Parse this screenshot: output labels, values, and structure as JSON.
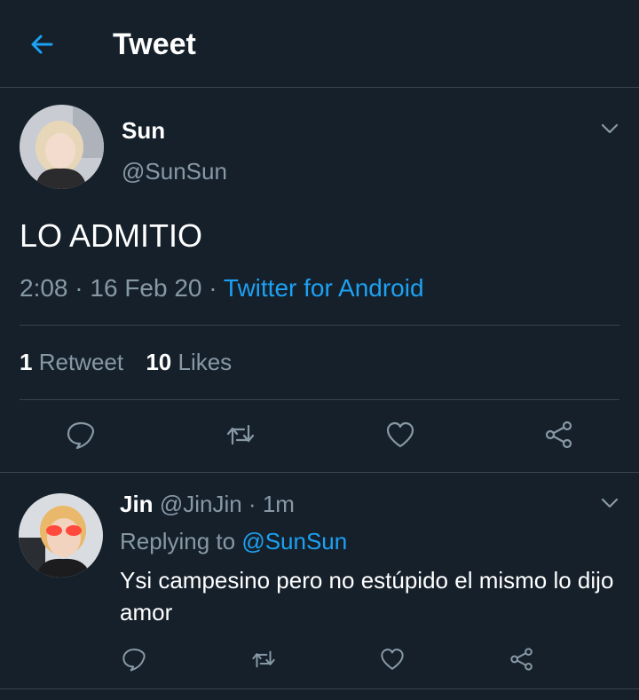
{
  "header": {
    "title": "Tweet",
    "back_icon": "arrow-left-icon"
  },
  "colors": {
    "background": "#15202b",
    "accent": "#1da1f2",
    "muted": "#8899a6",
    "divider": "#38444d"
  },
  "tweet": {
    "author_name": "Sun",
    "author_handle": "@SunSun",
    "text": "LO ADMITIO",
    "time": "2:08",
    "date": "16 Feb 20",
    "source": "Twitter for Android",
    "retweets_count": "1",
    "retweets_label": "Retweet",
    "likes_count": "10",
    "likes_label": "Likes",
    "actions": [
      "reply-icon",
      "retweet-icon",
      "like-icon",
      "share-icon"
    ]
  },
  "reply": {
    "author_name": "Jin",
    "author_handle": "@JinJin",
    "time": "1m",
    "replying_prefix": "Replying to",
    "replying_to": "@SunSun",
    "text": "Ysi campesino pero no estúpido el mismo lo dijo amor"
  }
}
